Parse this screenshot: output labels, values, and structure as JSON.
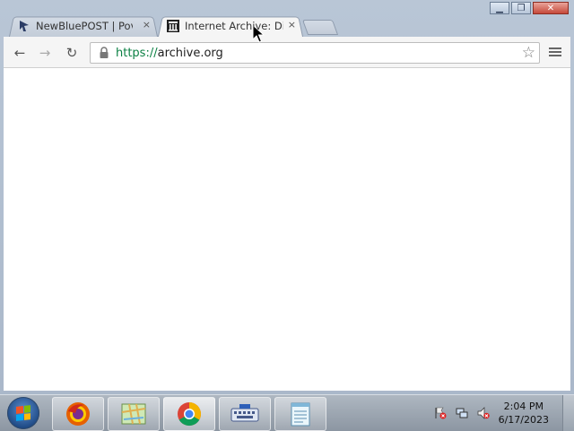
{
  "window": {
    "controls": [
      {
        "name": "minimize",
        "glyph": "▁"
      },
      {
        "name": "maximize",
        "glyph": "❐"
      },
      {
        "name": "close",
        "glyph": "✕"
      }
    ]
  },
  "tabs": [
    {
      "title": "NewBluePOST | Pov",
      "icon": "newblue-favicon",
      "active": false,
      "close": "×"
    },
    {
      "title": "Internet Archive: Dig",
      "icon": "archive-favicon",
      "active": true,
      "close": "×"
    }
  ],
  "toolbar": {
    "back": "←",
    "forward": "→",
    "reload": "↻",
    "url_scheme": "https://",
    "url_host": "archive.org",
    "star": "☆"
  },
  "taskbar": {
    "time": "2:04 PM",
    "date": "6/17/2023",
    "apps": [
      "firefox-icon",
      "maps-icon",
      "chrome-icon",
      "keyboard-icon",
      "notepad-icon"
    ]
  },
  "colors": {
    "frame": "#b9c6d6",
    "url_scheme": "#0b8043",
    "taskbar": "#9aa4af"
  }
}
